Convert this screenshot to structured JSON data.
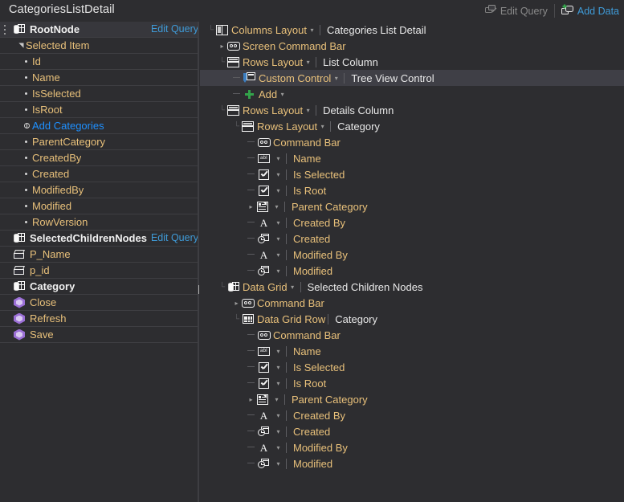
{
  "header": {
    "screen_title": "CategoriesListDetail",
    "actions": [
      {
        "label": "Edit Query",
        "icon": "edit-query-icon",
        "enabled": false
      },
      {
        "label": "Add Data",
        "icon": "add-data-icon",
        "enabled": true
      }
    ]
  },
  "members": {
    "edit_query_label": "Edit Query",
    "rows": [
      {
        "label": "RootNode",
        "icon": "query-icon",
        "style": "bold",
        "indent": 0,
        "selected": true,
        "grip": true,
        "edit_query": true
      },
      {
        "label": "Selected Item",
        "icon": "none",
        "style": "plain",
        "indent": 1,
        "expander": "expanded"
      },
      {
        "label": "Id",
        "icon": "bullet",
        "style": "plain",
        "indent": 2
      },
      {
        "label": "Name",
        "icon": "bullet",
        "style": "plain",
        "indent": 2
      },
      {
        "label": "IsSelected",
        "icon": "bullet",
        "style": "plain",
        "indent": 2
      },
      {
        "label": "IsRoot",
        "icon": "bullet",
        "style": "plain",
        "indent": 2
      },
      {
        "label": "Add Categories",
        "icon": "plus-circle-icon",
        "style": "link",
        "indent": 2
      },
      {
        "label": "ParentCategory",
        "icon": "bullet",
        "style": "plain",
        "indent": 2
      },
      {
        "label": "CreatedBy",
        "icon": "bullet",
        "style": "plain",
        "indent": 2
      },
      {
        "label": "Created",
        "icon": "bullet",
        "style": "plain",
        "indent": 2
      },
      {
        "label": "ModifiedBy",
        "icon": "bullet",
        "style": "plain",
        "indent": 2
      },
      {
        "label": "Modified",
        "icon": "bullet",
        "style": "plain",
        "indent": 2
      },
      {
        "label": "RowVersion",
        "icon": "bullet",
        "style": "plain",
        "indent": 2
      },
      {
        "label": "SelectedChildrenNodes",
        "icon": "query-icon",
        "style": "bold",
        "indent": 0,
        "edit_query": true
      },
      {
        "label": "P_Name",
        "icon": "parameter-icon",
        "style": "plain",
        "indent": 0
      },
      {
        "label": "p_id",
        "icon": "parameter-icon",
        "style": "plain",
        "indent": 0
      },
      {
        "label": "Category",
        "icon": "query-icon",
        "style": "bold",
        "indent": 0
      },
      {
        "label": "Close",
        "icon": "method-icon",
        "style": "plain",
        "indent": 0
      },
      {
        "label": "Refresh",
        "icon": "method-icon",
        "style": "plain",
        "indent": 0
      },
      {
        "label": "Save",
        "icon": "method-icon",
        "style": "plain",
        "indent": 0
      }
    ]
  },
  "content_tree": {
    "rows": [
      {
        "name": "Columns Layout",
        "icon": "columns-layout-icon",
        "caret": true,
        "divider": true,
        "sub": "Categories List Detail",
        "sub_color": "white",
        "indent": 0,
        "expander": "expanded",
        "elbow": false
      },
      {
        "name": "Screen Command Bar",
        "icon": "command-bar-icon",
        "caret": false,
        "divider": false,
        "sub": "",
        "indent": 1,
        "expander": "collapsed",
        "elbow": false
      },
      {
        "name": "Rows Layout",
        "icon": "rows-layout-icon",
        "caret": true,
        "divider": true,
        "sub": "List Column",
        "sub_color": "white",
        "indent": 1,
        "expander": "expanded",
        "elbow": false
      },
      {
        "name": "Custom Control",
        "icon": "custom-control-icon",
        "caret": true,
        "divider": true,
        "sub": "Tree View Control",
        "sub_color": "white",
        "indent": 2,
        "expander": "none",
        "elbow": true,
        "highlight": true
      },
      {
        "name": "Add",
        "icon": "add-icon",
        "caret": true,
        "divider": false,
        "sub": "",
        "indent": 2,
        "expander": "none",
        "elbow": true
      },
      {
        "name": "Rows Layout",
        "icon": "rows-layout-icon",
        "caret": true,
        "divider": true,
        "sub": "Details Column",
        "sub_color": "white",
        "indent": 1,
        "expander": "expanded",
        "elbow": false
      },
      {
        "name": "Rows Layout",
        "icon": "rows-layout-icon",
        "caret": true,
        "divider": true,
        "sub": "Category",
        "sub_color": "white",
        "indent": 2,
        "expander": "expanded",
        "elbow": false
      },
      {
        "name": "Command Bar",
        "icon": "command-bar-icon",
        "caret": false,
        "divider": false,
        "sub": "",
        "indent": 3,
        "expander": "none",
        "elbow": true
      },
      {
        "name": "",
        "icon": "textbox-icon",
        "caret": true,
        "divider": true,
        "sub": "Name",
        "sub_color": "amber",
        "indent": 3,
        "expander": "none",
        "elbow": true
      },
      {
        "name": "",
        "icon": "checkbox-icon",
        "caret": true,
        "divider": true,
        "sub": "Is Selected",
        "sub_color": "amber",
        "indent": 3,
        "expander": "none",
        "elbow": true
      },
      {
        "name": "",
        "icon": "checkbox-icon",
        "caret": true,
        "divider": true,
        "sub": "Is Root",
        "sub_color": "amber",
        "indent": 3,
        "expander": "none",
        "elbow": true
      },
      {
        "name": "",
        "icon": "details-icon",
        "caret": true,
        "divider": true,
        "sub": "Parent Category",
        "sub_color": "amber",
        "indent": 3,
        "expander": "collapsed",
        "elbow": false
      },
      {
        "name": "",
        "icon": "text-A-icon",
        "caret": true,
        "divider": true,
        "sub": "Created By",
        "sub_color": "amber",
        "indent": 3,
        "expander": "none",
        "elbow": true
      },
      {
        "name": "",
        "icon": "datetime-icon",
        "caret": true,
        "divider": true,
        "sub": "Created",
        "sub_color": "amber",
        "indent": 3,
        "expander": "none",
        "elbow": true
      },
      {
        "name": "",
        "icon": "text-A-icon",
        "caret": true,
        "divider": true,
        "sub": "Modified By",
        "sub_color": "amber",
        "indent": 3,
        "expander": "none",
        "elbow": true
      },
      {
        "name": "",
        "icon": "datetime-icon",
        "caret": true,
        "divider": true,
        "sub": "Modified",
        "sub_color": "amber",
        "indent": 3,
        "expander": "none",
        "elbow": true
      },
      {
        "name": "Data Grid",
        "icon": "data-grid-icon",
        "caret": true,
        "divider": true,
        "sub": "Selected Children Nodes",
        "sub_color": "white",
        "indent": 1,
        "expander": "expanded",
        "elbow": false
      },
      {
        "name": "Command Bar",
        "icon": "command-bar-icon",
        "caret": false,
        "divider": false,
        "sub": "",
        "indent": 2,
        "expander": "collapsed",
        "elbow": false
      },
      {
        "name": "Data Grid Row",
        "icon": "data-grid-row-icon",
        "caret": false,
        "divider": true,
        "sub": "Category",
        "sub_color": "white",
        "indent": 2,
        "expander": "expanded",
        "elbow": false
      },
      {
        "name": "Command Bar",
        "icon": "command-bar-icon",
        "caret": false,
        "divider": false,
        "sub": "",
        "indent": 3,
        "expander": "none",
        "elbow": true
      },
      {
        "name": "",
        "icon": "textbox-icon",
        "caret": true,
        "divider": true,
        "sub": "Name",
        "sub_color": "amber",
        "indent": 3,
        "expander": "none",
        "elbow": true
      },
      {
        "name": "",
        "icon": "checkbox-icon",
        "caret": true,
        "divider": true,
        "sub": "Is Selected",
        "sub_color": "amber",
        "indent": 3,
        "expander": "none",
        "elbow": true
      },
      {
        "name": "",
        "icon": "checkbox-icon",
        "caret": true,
        "divider": true,
        "sub": "Is Root",
        "sub_color": "amber",
        "indent": 3,
        "expander": "none",
        "elbow": true
      },
      {
        "name": "",
        "icon": "details-icon",
        "caret": true,
        "divider": true,
        "sub": "Parent Category",
        "sub_color": "amber",
        "indent": 3,
        "expander": "collapsed",
        "elbow": false
      },
      {
        "name": "",
        "icon": "text-A-icon",
        "caret": true,
        "divider": true,
        "sub": "Created By",
        "sub_color": "amber",
        "indent": 3,
        "expander": "none",
        "elbow": true
      },
      {
        "name": "",
        "icon": "datetime-icon",
        "caret": true,
        "divider": true,
        "sub": "Created",
        "sub_color": "amber",
        "indent": 3,
        "expander": "none",
        "elbow": true
      },
      {
        "name": "",
        "icon": "text-A-icon",
        "caret": true,
        "divider": true,
        "sub": "Modified By",
        "sub_color": "amber",
        "indent": 3,
        "expander": "none",
        "elbow": true
      },
      {
        "name": "",
        "icon": "datetime-icon",
        "caret": true,
        "divider": true,
        "sub": "Modified",
        "sub_color": "amber",
        "indent": 3,
        "expander": "none",
        "elbow": true
      }
    ]
  },
  "colors": {
    "background": "#2d2d30",
    "amber_text": "#e8c07a",
    "link_blue": "#1e90ff",
    "accent_blue": "#3f9bd8",
    "selected_row": "#37373c",
    "highlight_row": "#3f3f46"
  }
}
